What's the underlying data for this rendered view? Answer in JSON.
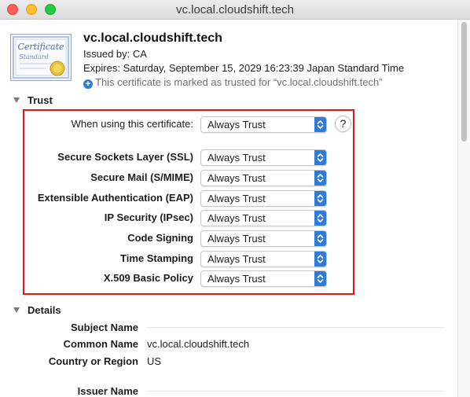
{
  "window": {
    "title": "vc.local.cloudshift.tech"
  },
  "certificate": {
    "icon": "certificate-icon",
    "icon_text_top": "Certificate",
    "icon_text_bottom": "Standard",
    "name": "vc.local.cloudshift.tech",
    "issued_by": "Issued by: CA",
    "expires": "Expires: Saturday, September 15, 2029 16:23:39 Japan Standard Time",
    "trusted_note": "This certificate is marked as trusted for “vc.local.cloudshift.tech”"
  },
  "trust": {
    "heading": "Trust",
    "when_using_label": "When using this certificate:",
    "when_using_value": "Always Trust",
    "help_label": "?",
    "policies": [
      {
        "label": "Secure Sockets Layer (SSL)",
        "value": "Always Trust"
      },
      {
        "label": "Secure Mail (S/MIME)",
        "value": "Always Trust"
      },
      {
        "label": "Extensible Authentication (EAP)",
        "value": "Always Trust"
      },
      {
        "label": "IP Security (IPsec)",
        "value": "Always Trust"
      },
      {
        "label": "Code Signing",
        "value": "Always Trust"
      },
      {
        "label": "Time Stamping",
        "value": "Always Trust"
      },
      {
        "label": "X.509 Basic Policy",
        "value": "Always Trust"
      }
    ]
  },
  "details": {
    "heading": "Details",
    "subject_name": "Subject Name",
    "common_name_label": "Common Name",
    "common_name_value": "vc.local.cloudshift.tech",
    "country_label": "Country or Region",
    "country_value": "US",
    "issuer_name": "Issuer Name"
  },
  "colors": {
    "accent": "#2f7bd8",
    "highlight_box": "#e2141c"
  }
}
